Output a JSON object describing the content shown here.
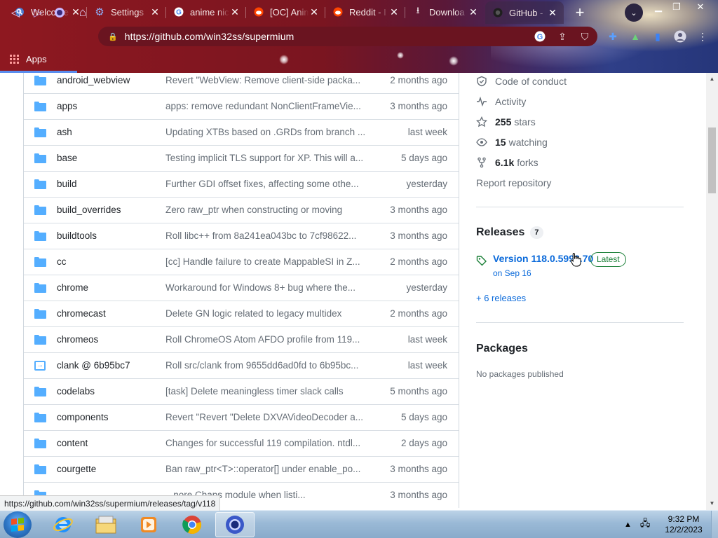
{
  "browser": {
    "tabs": [
      {
        "label": "Welcome",
        "icon": "search-icon",
        "active": false
      },
      {
        "label": "Settings",
        "icon": "gear-icon",
        "active": false
      },
      {
        "label": "anime nic",
        "icon": "google-icon",
        "active": false
      },
      {
        "label": "[OC] Anim",
        "icon": "reddit-icon",
        "active": false
      },
      {
        "label": "Reddit - I",
        "icon": "reddit-icon",
        "active": false
      },
      {
        "label": "Downloa",
        "icon": "download-icon",
        "active": false
      },
      {
        "label": "GitHub -",
        "icon": "github-icon",
        "active": true
      }
    ],
    "url": "https://github.com/win32ss/supermium",
    "bookmarks_apps": "Apps"
  },
  "files": [
    {
      "name": "android_webview",
      "type": "folder",
      "message": "Revert \"WebView: Remove client-side packa...",
      "age": "2 months ago"
    },
    {
      "name": "apps",
      "type": "folder",
      "message": "apps: remove redundant NonClientFrameVie...",
      "age": "3 months ago"
    },
    {
      "name": "ash",
      "type": "folder",
      "message": "Updating XTBs based on .GRDs from branch ...",
      "age": "last week"
    },
    {
      "name": "base",
      "type": "folder",
      "message": "Testing implicit TLS support for XP. This will a...",
      "age": "5 days ago"
    },
    {
      "name": "build",
      "type": "folder",
      "message": "Further GDI offset fixes, affecting some othe...",
      "age": "yesterday"
    },
    {
      "name": "build_overrides",
      "type": "folder",
      "message": "Zero raw_ptr when constructing or moving",
      "age": "3 months ago"
    },
    {
      "name": "buildtools",
      "type": "folder",
      "message": "Roll libc++ from 8a241ea043bc to 7cf98622...",
      "age": "3 months ago"
    },
    {
      "name": "cc",
      "type": "folder",
      "message": "[cc] Handle failure to create MappableSI in Z...",
      "age": "2 months ago"
    },
    {
      "name": "chrome",
      "type": "folder",
      "message": "Workaround for Windows 8+ bug where the...",
      "age": "yesterday"
    },
    {
      "name": "chromecast",
      "type": "folder",
      "message": "Delete GN logic related to legacy multidex",
      "age": "2 months ago"
    },
    {
      "name": "chromeos",
      "type": "folder",
      "message": "Roll ChromeOS Atom AFDO profile from 119...",
      "age": "last week"
    },
    {
      "name": "clank @ 6b95bc7",
      "type": "submodule",
      "message": "Roll src/clank from 9655dd6ad0fd to 6b95bc...",
      "age": "last week"
    },
    {
      "name": "codelabs",
      "type": "folder",
      "message": "[task] Delete meaningless timer slack calls",
      "age": "5 months ago"
    },
    {
      "name": "components",
      "type": "folder",
      "message": "Revert \"Revert \"Delete DXVAVideoDecoder a...",
      "age": "5 days ago"
    },
    {
      "name": "content",
      "type": "folder",
      "message": "Changes for successful 119 compilation. ntdl...",
      "age": "2 days ago"
    },
    {
      "name": "courgette",
      "type": "folder",
      "message": "Ban raw_ptr<T>::operator[] under enable_po...",
      "age": "3 months ago"
    },
    {
      "name": "",
      "type": "folder",
      "message": "...nore Chaps module when listi...",
      "age": "3 months ago"
    }
  ],
  "sidebar": {
    "code_of_conduct": "Code of conduct",
    "activity": "Activity",
    "stars_count": "255",
    "stars_label": "stars",
    "watching_count": "15",
    "watching_label": "watching",
    "forks_count": "6.1k",
    "forks_label": "forks",
    "report": "Report repository",
    "releases_heading": "Releases",
    "releases_count": "7",
    "latest_release": "Version 118.0.5993.70",
    "latest_badge": "Latest",
    "release_date": "on Sep 16",
    "more_releases": "+ 6 releases",
    "packages_heading": "Packages",
    "packages_empty": "No packages published"
  },
  "status_bar_url": "https://github.com/win32ss/supermium/releases/tag/v118",
  "taskbar": {
    "time": "9:32 PM",
    "date": "12/2/2023"
  },
  "colors": {
    "folder": "#54aeff",
    "link": "#0969da",
    "latest_green": "#1a7f37",
    "chrome_theme": "#8e1820"
  }
}
